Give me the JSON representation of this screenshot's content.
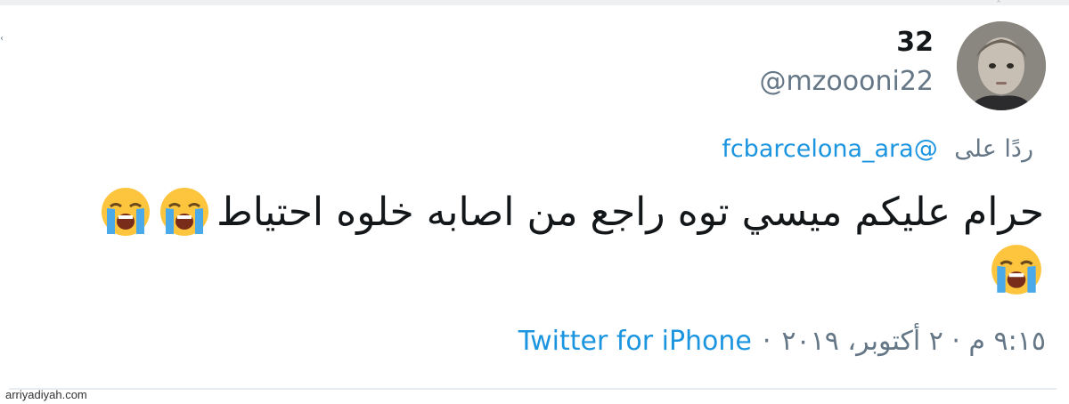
{
  "tweet": {
    "display_name": "32",
    "handle": "@mzoooni22",
    "reply_prefix": "ردًا على",
    "reply_target": "fcbarcelona_ara@",
    "text": "حرام عليكم ميسي توه راجع من اصابه خلوه احتياط",
    "emoji_icon": "loudly-crying-face-icon",
    "emoji_count": 3,
    "source": "Twitter for iPhone",
    "separator": "·",
    "datetime": "٩:١٥ م · ٢ أكتوبر، ٢٠١٩"
  },
  "watermark": "arriyadiyah.com",
  "colors": {
    "link": "#1b95e0",
    "secondary_text": "#657786",
    "primary_text": "#14171a"
  }
}
